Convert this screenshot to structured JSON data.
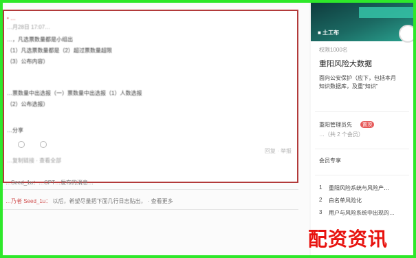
{
  "post": {
    "lines": [
      {
        "text": "• …",
        "style": "red"
      },
      {
        "text": "…月28日 17:07…",
        "style": "light"
      },
      {
        "text": "…，凡选票数量都是小组出",
        "style": ""
      },
      {
        "text": "（1）凡选票数量都是（2）超过票数量超限",
        "style": ""
      },
      {
        "text": "（3）公布内容）",
        "style": ""
      },
      {
        "text": "…票数量中出选报（一）票数量中出选报（1）人数选报",
        "style": ""
      },
      {
        "text": "（2）公布选报）",
        "style": ""
      },
      {
        "text": "…分享",
        "style": ""
      },
      {
        "text": "…复制链接 · 查看全部",
        "style": "light"
      }
    ],
    "reply_label": "回复 · 举报",
    "comment_1": "…Seed_1u：…CPT…发布的消息…",
    "comment_2_highlight": "…乃者 Seed_1u：",
    "comment_2_rest": "以后，希望尽量把下面几行日志贴出， · 查看更多"
  },
  "sidebar": {
    "banner_label": "■ 土工布",
    "subtitle": "权限1000名",
    "title": "重阳风险大数据",
    "desc_lines": [
      "面向公安保护（应下，包括本月",
      "知识数据库，及重\"知识\""
    ],
    "author": "重阳管理员先",
    "badge": "置顶",
    "author_sub": "…（共 2 个会员）",
    "section_title": "会员专享",
    "list": [
      {
        "num": "1",
        "text": "重阳风险系统与风险产…"
      },
      {
        "num": "2",
        "text": "白名单风险化"
      },
      {
        "num": "3",
        "text": "用户与风险系统中出现的…"
      }
    ]
  },
  "watermark": "配资资讯",
  "colors": {
    "frame": "#2ee82a",
    "highlight_border": "#b23a3a",
    "watermark": "#e8130f"
  }
}
